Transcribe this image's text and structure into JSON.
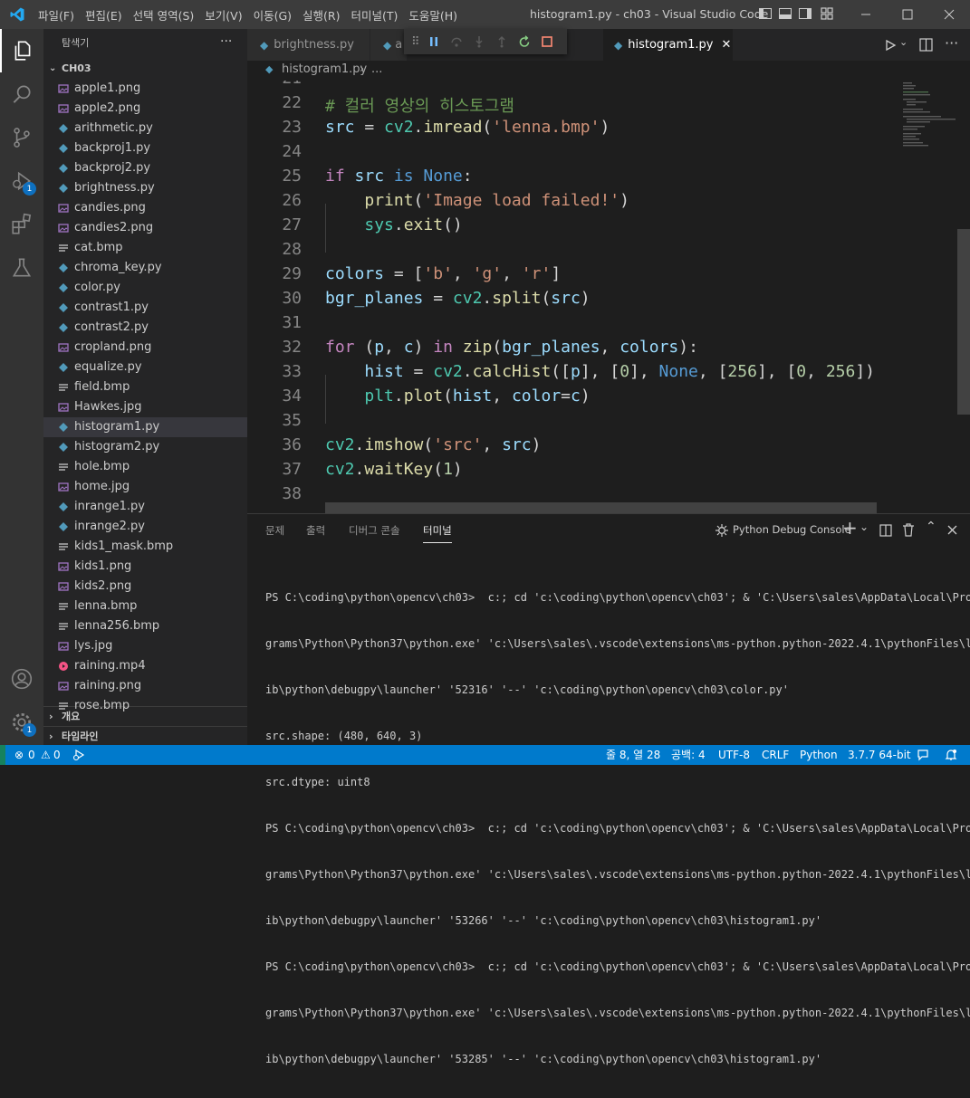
{
  "titlebar": {
    "menu": [
      "파일(F)",
      "편집(E)",
      "선택 영역(S)",
      "보기(V)",
      "이동(G)",
      "실행(R)",
      "터미널(T)",
      "도움말(H)"
    ],
    "window_title": "histogram1.py - ch03 - Visual Studio Code"
  },
  "activity": {
    "debug_badge": "1",
    "settings_badge": "1"
  },
  "sidebar": {
    "title": "탐색기",
    "more": "···",
    "folder": "CH03",
    "files": [
      {
        "name": "apple1.png",
        "type": "image"
      },
      {
        "name": "apple2.png",
        "type": "image"
      },
      {
        "name": "arithmetic.py",
        "type": "python"
      },
      {
        "name": "backproj1.py",
        "type": "python"
      },
      {
        "name": "backproj2.py",
        "type": "python"
      },
      {
        "name": "brightness.py",
        "type": "python"
      },
      {
        "name": "candies.png",
        "type": "image"
      },
      {
        "name": "candies2.png",
        "type": "image"
      },
      {
        "name": "cat.bmp",
        "type": "text"
      },
      {
        "name": "chroma_key.py",
        "type": "python"
      },
      {
        "name": "color.py",
        "type": "python"
      },
      {
        "name": "contrast1.py",
        "type": "python"
      },
      {
        "name": "contrast2.py",
        "type": "python"
      },
      {
        "name": "cropland.png",
        "type": "image"
      },
      {
        "name": "equalize.py",
        "type": "python"
      },
      {
        "name": "field.bmp",
        "type": "text"
      },
      {
        "name": "Hawkes.jpg",
        "type": "image"
      },
      {
        "name": "histogram1.py",
        "type": "python"
      },
      {
        "name": "histogram2.py",
        "type": "python"
      },
      {
        "name": "hole.bmp",
        "type": "text"
      },
      {
        "name": "home.jpg",
        "type": "image"
      },
      {
        "name": "inrange1.py",
        "type": "python"
      },
      {
        "name": "inrange2.py",
        "type": "python"
      },
      {
        "name": "kids1_mask.bmp",
        "type": "text"
      },
      {
        "name": "kids1.png",
        "type": "image"
      },
      {
        "name": "kids2.png",
        "type": "image"
      },
      {
        "name": "lenna.bmp",
        "type": "text"
      },
      {
        "name": "lenna256.bmp",
        "type": "text"
      },
      {
        "name": "lys.jpg",
        "type": "image"
      },
      {
        "name": "raining.mp4",
        "type": "video"
      },
      {
        "name": "raining.png",
        "type": "image"
      },
      {
        "name": "rose.bmp",
        "type": "text"
      }
    ],
    "selected": "histogram1.py",
    "outline": "개요",
    "timeline": "타임라인"
  },
  "editor": {
    "tabs": [
      {
        "label": "brightness.py",
        "active": false
      },
      {
        "label": "a",
        "active": false
      },
      {
        "label": "histogram1.py",
        "active": true
      }
    ],
    "breadcrumb": [
      "histogram1.py",
      "..."
    ],
    "line_numbers": [
      "21",
      "22",
      "23",
      "24",
      "25",
      "26",
      "27",
      "28",
      "29",
      "30",
      "31",
      "32",
      "33",
      "34",
      "35",
      "36",
      "37",
      "38"
    ]
  },
  "panel": {
    "tabs": [
      "문제",
      "출력",
      "디버그 콘솔",
      "터미널"
    ],
    "active_tab": "터미널",
    "terminal_name": "Python Debug Console",
    "lines": [
      "PS C:\\coding\\python\\opencv\\ch03>  c:; cd 'c:\\coding\\python\\opencv\\ch03'; & 'C:\\Users\\sales\\AppData\\Local\\Pro",
      "grams\\Python\\Python37\\python.exe' 'c:\\Users\\sales\\.vscode\\extensions\\ms-python.python-2022.4.1\\pythonFiles\\l",
      "ib\\python\\debugpy\\launcher' '52316' '--' 'c:\\coding\\python\\opencv\\ch03\\color.py'",
      "src.shape: (480, 640, 3)",
      "src.dtype: uint8",
      "PS C:\\coding\\python\\opencv\\ch03>  c:; cd 'c:\\coding\\python\\opencv\\ch03'; & 'C:\\Users\\sales\\AppData\\Local\\Pro",
      "grams\\Python\\Python37\\python.exe' 'c:\\Users\\sales\\.vscode\\extensions\\ms-python.python-2022.4.1\\pythonFiles\\l",
      "ib\\python\\debugpy\\launcher' '53266' '--' 'c:\\coding\\python\\opencv\\ch03\\histogram1.py'",
      "PS C:\\coding\\python\\opencv\\ch03>  c:; cd 'c:\\coding\\python\\opencv\\ch03'; & 'C:\\Users\\sales\\AppData\\Local\\Pro",
      "grams\\Python\\Python37\\python.exe' 'c:\\Users\\sales\\.vscode\\extensions\\ms-python.python-2022.4.1\\pythonFiles\\l",
      "ib\\python\\debugpy\\launcher' '53285' '--' 'c:\\coding\\python\\opencv\\ch03\\histogram1.py'"
    ]
  },
  "statusbar": {
    "errors": "0",
    "warnings": "0",
    "position": "줄 8, 열 28",
    "spaces": "공백: 4",
    "encoding": "UTF-8",
    "eol": "CRLF",
    "language": "Python",
    "interpreter": "3.7.7 64-bit"
  },
  "colors": {
    "statusbar": "#007acc",
    "activitybar": "#333333",
    "sidebar": "#252526",
    "editor": "#1e1e1e"
  }
}
